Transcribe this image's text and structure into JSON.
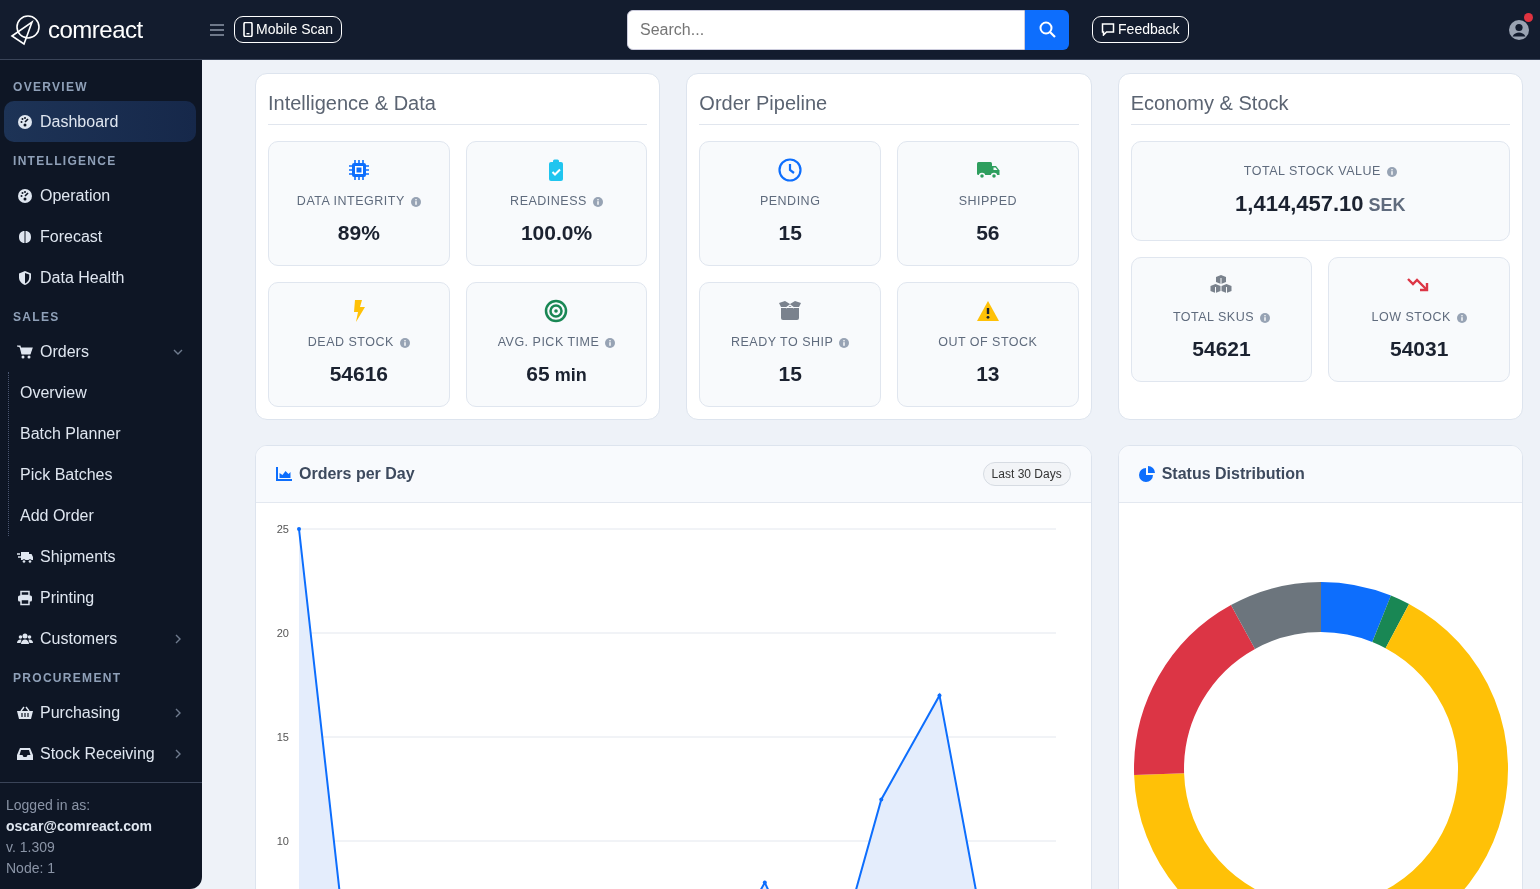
{
  "brand": {
    "name": "comreact"
  },
  "topbar": {
    "mobile_scan": "Mobile Scan",
    "search": {
      "placeholder": "Search..."
    },
    "feedback": "Feedback",
    "notification": true
  },
  "sidebar": {
    "sections": [
      {
        "title": "OVERVIEW",
        "items": [
          {
            "label": "Dashboard",
            "kind": "link",
            "selected": true
          }
        ]
      },
      {
        "title": "INTELLIGENCE",
        "items": [
          {
            "label": "Operation",
            "kind": "link",
            "selected": false
          },
          {
            "label": "Forecast",
            "kind": "link",
            "selected": false
          },
          {
            "label": "Data Health",
            "kind": "link",
            "selected": false
          }
        ]
      },
      {
        "title": "SALES",
        "items": [
          {
            "label": "Orders",
            "kind": "group",
            "expanded": true,
            "selected": false,
            "children": [
              {
                "label": "Overview",
                "selected": false
              },
              {
                "label": "Batch Planner",
                "selected": false
              },
              {
                "label": "Pick Batches",
                "selected": false
              },
              {
                "label": "Add Order",
                "selected": false
              }
            ]
          },
          {
            "label": "Shipments",
            "kind": "link",
            "selected": false
          },
          {
            "label": "Printing",
            "kind": "link",
            "selected": false
          },
          {
            "label": "Customers",
            "kind": "group",
            "expanded": false,
            "selected": false
          }
        ]
      },
      {
        "title": "PROCUREMENT",
        "items": [
          {
            "label": "Purchasing",
            "kind": "group",
            "expanded": false,
            "selected": false
          },
          {
            "label": "Stock Receiving",
            "kind": "group",
            "expanded": false,
            "selected": false
          }
        ]
      }
    ],
    "footer": {
      "caption": "Logged in as:",
      "user": "oscar@comreact.com",
      "version": "v. 1.309",
      "node": "Node: 1"
    }
  },
  "panels": [
    {
      "title": "Intelligence & Data",
      "tiles": [
        {
          "kind": "icon",
          "label": "DATA INTEGRITY",
          "info": true,
          "value": "89%"
        },
        {
          "kind": "icon",
          "label": "READINESS",
          "info": true,
          "value": "100.0%"
        },
        {
          "kind": "icon",
          "label": "DEAD STOCK",
          "info": true,
          "value": "54616"
        },
        {
          "kind": "icon",
          "label": "AVG. PICK TIME",
          "info": true,
          "value": "65",
          "unit": "min"
        }
      ]
    },
    {
      "title": "Order Pipeline",
      "tiles": [
        {
          "kind": "icon",
          "label": "PENDING",
          "info": false,
          "value": "15"
        },
        {
          "kind": "icon",
          "label": "SHIPPED",
          "info": false,
          "value": "56"
        },
        {
          "kind": "icon",
          "label": "READY TO SHIP",
          "info": true,
          "value": "15"
        },
        {
          "kind": "icon",
          "label": "OUT OF STOCK",
          "info": false,
          "value": "13"
        }
      ]
    },
    {
      "title": "Economy & Stock",
      "tiles": [
        {
          "kind": "wide",
          "label": "TOTAL STOCK VALUE",
          "info": true,
          "value": "1,414,457.10",
          "unit": "SEK"
        },
        {
          "kind": "icon",
          "label": "TOTAL SKUS",
          "info": true,
          "value": "54621"
        },
        {
          "kind": "icon",
          "label": "LOW STOCK",
          "info": true,
          "value": "54031"
        }
      ]
    }
  ],
  "orders_chart": {
    "title": "Orders per Day",
    "range": "Last 30 Days",
    "chart_data": {
      "type": "area",
      "categories": [
        null,
        null,
        null,
        null,
        null,
        null,
        null,
        null,
        null,
        null,
        null,
        null,
        null,
        null
      ],
      "ylim": [
        0,
        25
      ],
      "yticks": [
        10,
        15,
        20,
        25
      ],
      "grid": true,
      "series": [
        {
          "color": "#0d6efd",
          "values": [
            25,
            0,
            0,
            1,
            0,
            2,
            1,
            3,
            8,
            2,
            12,
            17,
            2,
            0
          ]
        }
      ]
    }
  },
  "status_chart": {
    "title": "Status Distribution"
  }
}
